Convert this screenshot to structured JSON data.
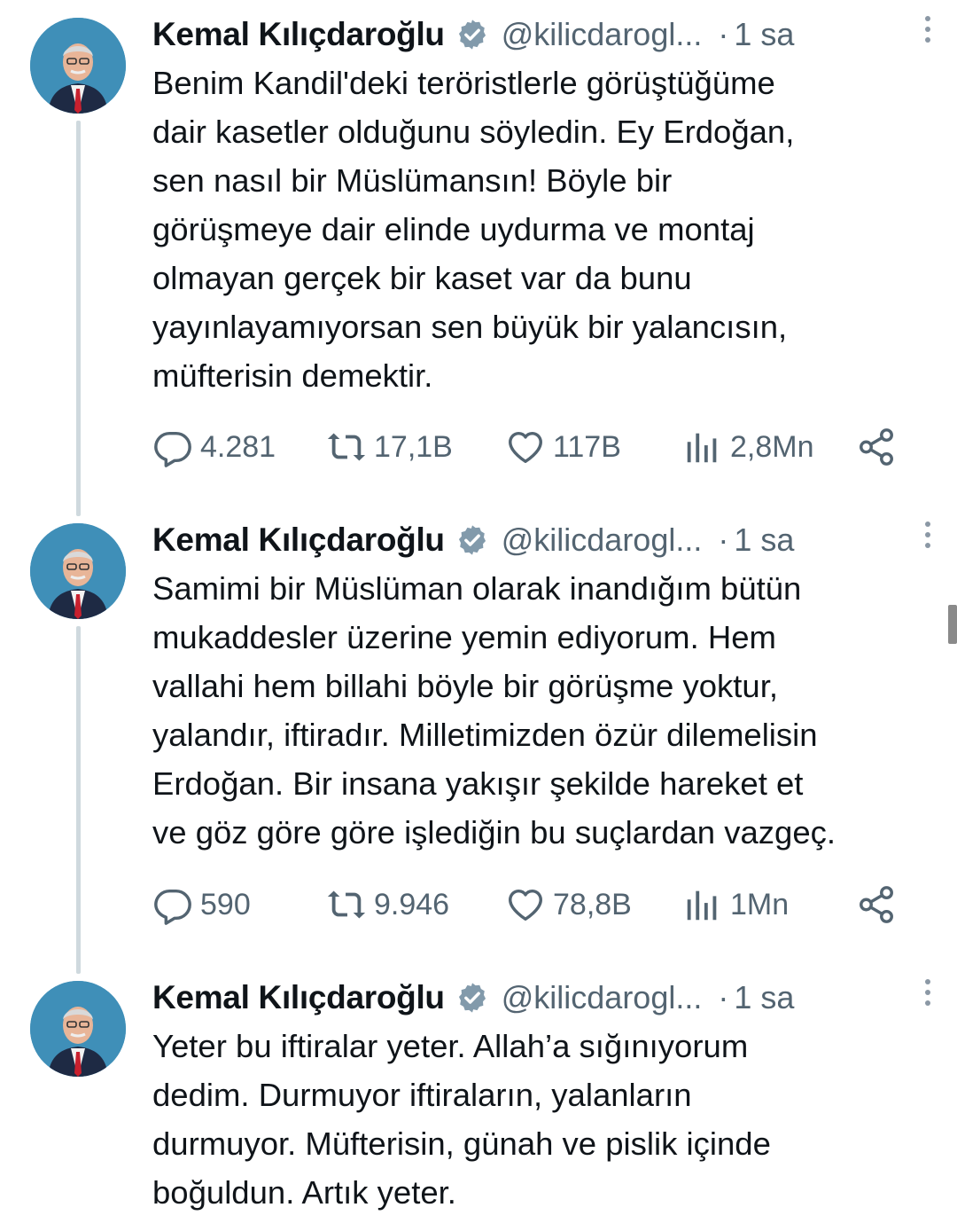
{
  "tweets": [
    {
      "author": "Kemal Kılıçdaroğlu",
      "handle": "@kilicdarogl...",
      "separator": "·",
      "time": "1 sa",
      "text": "Benim Kandil'deki teröristlerle görüştüğüme\ndair kasetler olduğunu söyledin. Ey Erdoğan,\nsen nasıl bir Müslümansın! Böyle bir\ngörüşmeye dair elinde uydurma ve montaj\nolmayan gerçek bir kaset var da bunu\nyayınlayamıyorsan sen büyük bir yalancısın,\nmüfterisin demektir.",
      "replies": "4.281",
      "retweets": "17,1B",
      "likes": "117B",
      "views": "2,8Mn"
    },
    {
      "author": "Kemal Kılıçdaroğlu",
      "handle": "@kilicdarogl...",
      "separator": "·",
      "time": "1 sa",
      "text": "Samimi bir Müslüman olarak inandığım bütün\nmukaddesler üzerine yemin ediyorum. Hem\nvallahi hem billahi böyle bir görüşme yoktur,\nyalandır, iftiradır. Milletimizden özür dilemelisin\nErdoğan. Bir insana yakışır şekilde hareket et\nve göz göre göre işlediğin bu suçlardan vazgeç.",
      "replies": "590",
      "retweets": "9.946",
      "likes": "78,8B",
      "views": "1Mn"
    },
    {
      "author": "Kemal Kılıçdaroğlu",
      "handle": "@kilicdarogl...",
      "separator": "·",
      "time": "1 sa",
      "text": "Yeter bu iftiralar yeter. Allah’a sığınıyorum\ndedim. Durmuyor iftiraların, yalanların\ndurmuyor. Müfterisin, günah ve pislik içinde\nboğuldun. Artık yeter."
    }
  ],
  "colors": {
    "text": "#0f1419",
    "secondary": "#536471",
    "thread_line": "#cfd9de",
    "avatar_bg": "#3f8fb8",
    "verified_badge": "#829aab"
  }
}
